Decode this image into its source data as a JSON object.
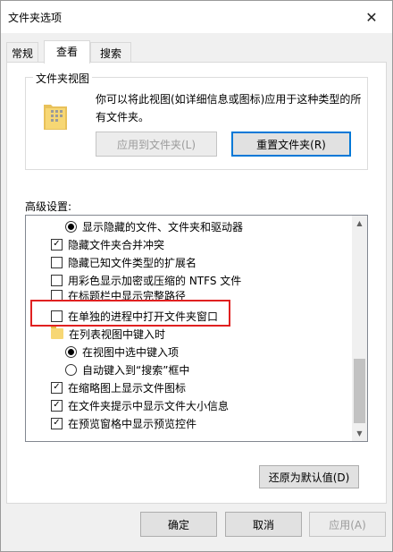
{
  "window": {
    "title": "文件夹选项",
    "close_glyph": "✕"
  },
  "tabs": [
    {
      "label": "常规"
    },
    {
      "label": "查看",
      "active": true
    },
    {
      "label": "搜索"
    }
  ],
  "folder_views": {
    "title": "文件夹视图",
    "description": "你可以将此视图(如详细信息或图标)应用于这种类型的所有文件夹。",
    "apply_button": "应用到文件夹(L)",
    "reset_button": "重置文件夹(R)"
  },
  "advanced": {
    "label": "高级设置:",
    "items": [
      {
        "type": "radio",
        "checked": true,
        "label": "显示隐藏的文件、文件夹和驱动器",
        "indent": 1
      },
      {
        "type": "checkbox",
        "checked": true,
        "label": "隐藏文件夹合并冲突",
        "indent": 0
      },
      {
        "type": "checkbox",
        "checked": false,
        "label": "隐藏已知文件类型的扩展名",
        "indent": 0
      },
      {
        "type": "checkbox",
        "checked": false,
        "label": "用彩色显示加密或压缩的 NTFS 文件",
        "indent": 0
      },
      {
        "type": "checkbox",
        "checked": false,
        "label": "在标题栏中显示完整路径",
        "indent": 0
      },
      {
        "type": "checkbox",
        "checked": false,
        "label": "在单独的进程中打开文件夹窗口",
        "indent": 0
      },
      {
        "type": "folder",
        "label": "在列表视图中键入时",
        "indent": 0
      },
      {
        "type": "radio",
        "checked": true,
        "label": "在视图中选中键入项",
        "indent": 1
      },
      {
        "type": "radio",
        "checked": false,
        "label": "自动键入到“搜索”框中",
        "indent": 1
      },
      {
        "type": "checkbox",
        "checked": true,
        "label": "在缩略图上显示文件图标",
        "indent": 0
      },
      {
        "type": "checkbox",
        "checked": true,
        "label": "在文件夹提示中显示文件大小信息",
        "indent": 0
      },
      {
        "type": "checkbox",
        "checked": true,
        "label": "在预览窗格中显示预览控件",
        "indent": 0
      }
    ],
    "restore_button": "还原为默认值(D)"
  },
  "footer": {
    "ok": "确定",
    "cancel": "取消",
    "apply": "应用(A)"
  },
  "colors": {
    "highlight": "#e02020",
    "focus": "#0078d7"
  }
}
